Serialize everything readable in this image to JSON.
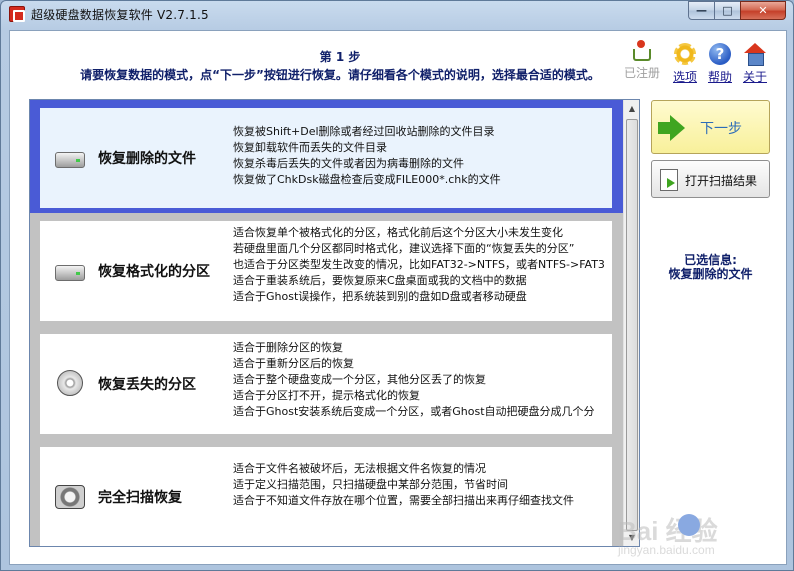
{
  "window": {
    "title": "超级硬盘数据恢复软件 V2.7.1.5",
    "controls": {
      "minimize": "—",
      "maximize": "□",
      "close": "✕"
    }
  },
  "header": {
    "step": "第 1 步",
    "instruction": "请要恢复数据的模式，点“下一步”按钮进行恢复。请仔细看各个模式的说明，选择最合适的模式。"
  },
  "toolbar": {
    "register": {
      "label": "已注册",
      "icon": "cart-icon",
      "enabled": false
    },
    "options": {
      "label": "选项",
      "icon": "gear-icon"
    },
    "help": {
      "label": "帮助",
      "icon": "help-icon"
    },
    "about": {
      "label": "关于",
      "icon": "home-icon"
    }
  },
  "modes": [
    {
      "name": "恢复删除的文件",
      "icon": "hard-disk-icon",
      "selected": true,
      "desc": [
        "恢复被Shift+Del删除或者经过回收站删除的文件目录",
        "恢复卸载软件而丢失的文件目录",
        "恢复杀毒后丢失的文件或者因为病毒删除的文件",
        "恢复做了ChkDsk磁盘检查后变成FILE000*.chk的文件"
      ]
    },
    {
      "name": "恢复格式化的分区",
      "icon": "hard-disk-icon",
      "selected": false,
      "desc": [
        "适合恢复单个被格式化的分区，格式化前后这个分区大小未发生变化",
        "若硬盘里面几个分区都同时格式化，建议选择下面的“恢复丢失的分区”",
        "也适合于分区类型发生改变的情况，比如FAT32->NTFS，或者NTFS->FAT3",
        "适合于重装系统后，要恢复原来C盘桌面或我的文档中的数据",
        "适合于Ghost误操作，把系统装到别的盘如D盘或者移动硬盘"
      ]
    },
    {
      "name": "恢复丢失的分区",
      "icon": "disk-platter-icon",
      "selected": false,
      "desc": [
        "适合于删除分区的恢复",
        "适合于重新分区后的恢复",
        "适合于整个硬盘变成一个分区，其他分区丢了的恢复",
        "适合于分区打不开，提示格式化的恢复",
        "适合于Ghost安装系统后变成一个分区，或者Ghost自动把硬盘分成几个分"
      ]
    },
    {
      "name": "完全扫描恢复",
      "icon": "scan-disk-icon",
      "selected": false,
      "desc": [
        "适合于文件名被破坏后，无法根据文件名恢复的情况",
        "适于定义扫描范围，只扫描硬盘中某部分范围，节省时间",
        "适合于不知道文件存放在哪个位置，需要全部扫描出来再仔细查找文件"
      ]
    }
  ],
  "scrollbar": {
    "up": "▲",
    "down": "▼"
  },
  "side": {
    "next_label": "下一步",
    "open_scan_label": "打开扫描结果",
    "selected_label": "已选信息:",
    "selected_value": "恢复删除的文件"
  },
  "watermark": {
    "text": "Bai 经验",
    "url": "jingyan.baidu.com"
  },
  "colors": {
    "selected_border": "#4a5bd6",
    "selected_fill": "#eaf3fd",
    "header_text": "#10206a",
    "next_button": "#f8f09a"
  }
}
